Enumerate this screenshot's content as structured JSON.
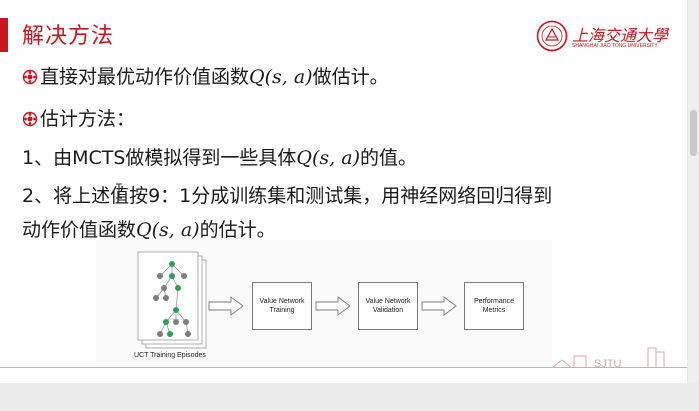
{
  "slide": {
    "title": "解决方法",
    "logo": {
      "cn": "上海交通大學",
      "en": "SHANGHAI JIAO TONG UNIVERSITY"
    },
    "lines": [
      {
        "pre": "直接对最优动作价值函数",
        "math": "Q(s, a)",
        "post": "做估计。",
        "bullet": true
      },
      {
        "pre": "估计方法：",
        "math": "",
        "post": "",
        "bullet": true
      },
      {
        "pre": "1、由MCTS做模拟得到一些具体",
        "math": "Q(s, a)",
        "post": "的值。",
        "bullet": false
      },
      {
        "pre": "2、将上述值按9：1分成训练集和测试集，用神经网络回归得到",
        "math": "",
        "post": "",
        "bullet": false
      },
      {
        "pre": "动作价值函数",
        "math": "Q(s, a)",
        "post": "的估计。",
        "bullet": false
      }
    ],
    "diagram": {
      "caption": "UCT Training Episodes",
      "boxes": [
        {
          "line1": "Value Network",
          "line2": "Training"
        },
        {
          "line1": "Value Network",
          "line2": "Validation"
        },
        {
          "line1": "Performance",
          "line2": "Metrics"
        }
      ]
    },
    "footer_brand": "SJTU"
  },
  "colors": {
    "accent": "#c8161d",
    "tree_green": "#2e9d57",
    "tree_gray": "#7d7d7d"
  },
  "icons": [
    "bullet-flower-icon",
    "sjtu-seal-icon",
    "arrow-right-icon",
    "text-cursor-icon"
  ]
}
